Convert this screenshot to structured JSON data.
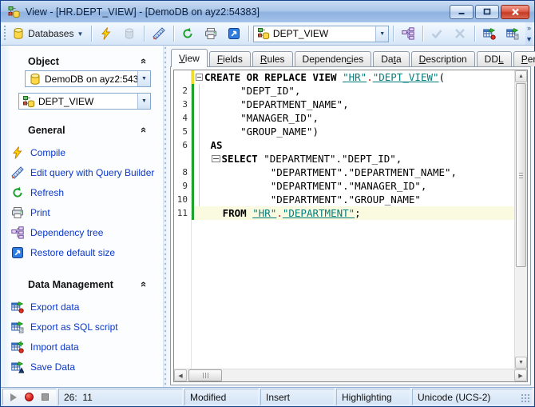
{
  "window": {
    "title": "View - [HR.DEPT_VIEW] - [DemoDB on ayz2:54383]"
  },
  "toolbar": {
    "databases_button": "Databases",
    "object_combo_value": "DEPT_VIEW"
  },
  "sidebar": {
    "object": {
      "header": "Object",
      "database_combo": "DemoDB on ayz2:54383",
      "view_combo": "DEPT_VIEW"
    },
    "general": {
      "header": "General",
      "items": [
        {
          "label": "Compile"
        },
        {
          "label": "Edit query with Query Builder"
        },
        {
          "label": "Refresh"
        },
        {
          "label": "Print"
        },
        {
          "label": "Dependency tree"
        },
        {
          "label": "Restore default size"
        }
      ]
    },
    "data_management": {
      "header": "Data Management",
      "items": [
        {
          "label": "Export data"
        },
        {
          "label": "Export as SQL script"
        },
        {
          "label": "Import data"
        },
        {
          "label": "Save Data"
        }
      ]
    }
  },
  "tabs": [
    {
      "pre": "",
      "accel": "V",
      "post": "iew",
      "active": true
    },
    {
      "pre": "",
      "accel": "F",
      "post": "ields",
      "active": false
    },
    {
      "pre": "",
      "accel": "R",
      "post": "ules",
      "active": false
    },
    {
      "pre": "Dependen",
      "accel": "c",
      "post": "ies",
      "active": false
    },
    {
      "pre": "Da",
      "accel": "t",
      "post": "a",
      "active": false
    },
    {
      "pre": "",
      "accel": "D",
      "post": "escription",
      "active": false
    },
    {
      "pre": "DD",
      "accel": "L",
      "post": "",
      "active": false
    },
    {
      "pre": "",
      "accel": "P",
      "post": "ermissions",
      "active": false
    }
  ],
  "editor": {
    "lines": [
      {
        "num": "",
        "kw": "CREATE OR REPLACE VIEW ",
        "l1": "\"HR\"",
        "dot": ".",
        "l2": "\"DEPT_VIEW\"",
        "tail": "("
      },
      {
        "num": "2",
        "text": "      \"DEPT_ID\","
      },
      {
        "num": "3",
        "text": "      \"DEPARTMENT_NAME\","
      },
      {
        "num": "4",
        "text": "      \"MANAGER_ID\","
      },
      {
        "num": "5",
        "text": "      \"GROUP_NAME\")"
      },
      {
        "num": "6",
        "kw": " AS"
      },
      {
        "num": "",
        "pre": " ",
        "kw": "SELECT ",
        "text": "\"DEPARTMENT\".\"DEPT_ID\","
      },
      {
        "num": "8",
        "text": "           \"DEPARTMENT\".\"DEPARTMENT_NAME\","
      },
      {
        "num": "9",
        "text": "           \"DEPARTMENT\".\"MANAGER_ID\","
      },
      {
        "num": "10",
        "text": "           \"DEPARTMENT\".\"GROUP_NAME\""
      },
      {
        "num": "11",
        "pre": "   ",
        "kw": "FROM ",
        "l1": "\"HR\"",
        "dot": ".",
        "l2": "\"DEPARTMENT\"",
        "tail": ";"
      }
    ]
  },
  "statusbar": {
    "position": "26:  11",
    "modified": "Modified",
    "insert_mode": "Insert",
    "highlighting": "Highlighting",
    "encoding": "Unicode (UCS-2)"
  },
  "icons": {
    "view-icon": "org-tree+db-cylinder",
    "database-icon": "yellow-cylinder",
    "compile-icon": "lightning-bolt",
    "query-builder-icon": "ruler-pencil",
    "refresh-icon": "circular-arrow",
    "print-icon": "printer",
    "restore-size-icon": "blue-square-arrow",
    "dependency-tree-icon": "org-chart",
    "apply-icon": "check",
    "cancel-icon": "x",
    "export-data-icon": "table-green-arrow-red-dot",
    "export-sql-icon": "table-green-arrow-page",
    "import-data-icon": "table-green-arrow-in",
    "save-data-icon": "table-green-arrow-dark"
  },
  "colors": {
    "titlebar": "#a9c6ea",
    "window_border": "#4f7dc0",
    "close_red": "#c63a26",
    "link_blue": "#0a37c8",
    "identifier_teal": "#007d7d",
    "dot_red": "#c42020",
    "change_green": "#1ba32b",
    "change_yellow": "#f0dd2a",
    "current_line_bg": "#fafae1"
  }
}
